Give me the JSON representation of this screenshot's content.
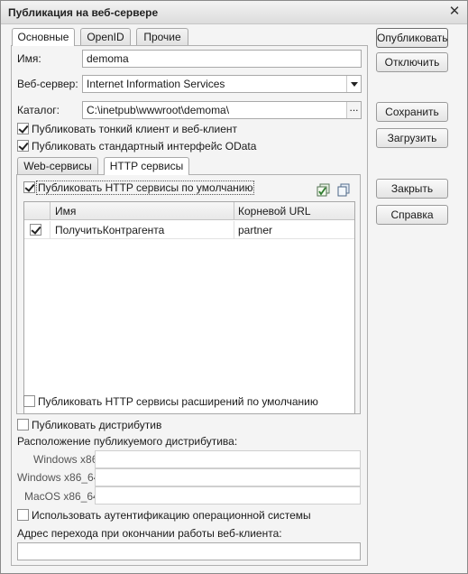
{
  "window": {
    "title": "Публикация на веб-сервере"
  },
  "main_tabs": [
    {
      "label": "Основные",
      "active": true
    },
    {
      "label": "OpenID",
      "active": false
    },
    {
      "label": "Прочие",
      "active": false
    }
  ],
  "fields": {
    "name": {
      "label": "Имя:",
      "value": "demoma"
    },
    "web_server": {
      "label": "Веб-сервер:",
      "value": "Internet Information Services"
    },
    "catalog": {
      "label": "Каталог:",
      "value": "C:\\inetpub\\wwwroot\\demoma\\",
      "browse": "..."
    }
  },
  "checks": {
    "thin_client": {
      "label": "Публиковать тонкий клиент и веб-клиент",
      "checked": true
    },
    "odata": {
      "label": "Публиковать стандартный интерфейс OData",
      "checked": true
    }
  },
  "inner_tabs": [
    {
      "label": "Web-сервисы",
      "active": false
    },
    {
      "label": "HTTP сервисы",
      "active": true
    }
  ],
  "http": {
    "default_publish": {
      "label": "Публиковать HTTP сервисы по умолчанию",
      "checked": true
    },
    "columns": [
      "Имя",
      "Корневой URL"
    ],
    "rows": [
      {
        "checked": true,
        "name": "ПолучитьКонтрагента",
        "url": "partner"
      }
    ],
    "ext_publish": {
      "label": "Публиковать HTTP сервисы расширений по умолчанию",
      "checked": false
    }
  },
  "distrib": {
    "publish": {
      "label": "Публиковать дистрибутив",
      "checked": false
    },
    "location_label": "Расположение публикуемого дистрибутива:",
    "win86": {
      "label": "Windows x86:",
      "value": ""
    },
    "win64": {
      "label": "Windows x86_64:",
      "value": ""
    },
    "mac64": {
      "label": "MacOS x86_64:",
      "value": ""
    }
  },
  "os_auth": {
    "label": "Использовать аутентификацию операционной системы",
    "checked": false
  },
  "exit_url": {
    "label": "Адрес перехода при окончании работы веб-клиента:",
    "value": ""
  },
  "buttons": {
    "publish": "Опубликовать",
    "disable": "Отключить",
    "save": "Сохранить",
    "load": "Загрузить",
    "close": "Закрыть",
    "help": "Справка"
  },
  "icons": {
    "close": "close-icon",
    "check_all": "check-all-icon",
    "copy": "copy-icon"
  }
}
